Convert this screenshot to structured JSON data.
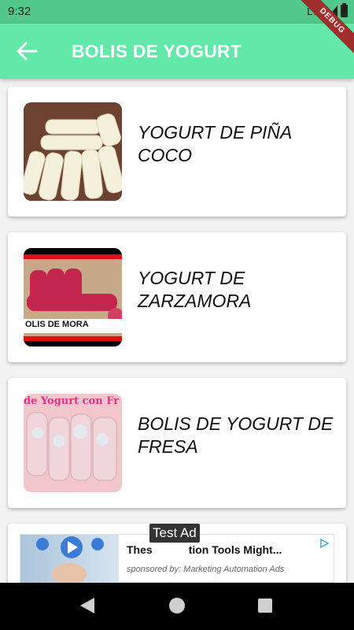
{
  "status_bar": {
    "time": "9:32",
    "network": "LTE"
  },
  "app_bar": {
    "title": "BOLIS DE YOGURT",
    "debug_banner": "DEBUG"
  },
  "items": [
    {
      "title": "YOGURT DE PIÑA COCO"
    },
    {
      "title": "YOGURT DE ZARZAMORA",
      "thumb_caption": "OLIS DE MORA"
    },
    {
      "title": "BOLIS DE YOGURT DE FRESA",
      "thumb_caption": "de Yogurt con Fr"
    }
  ],
  "ad": {
    "label": "Test Ad",
    "headline": "These ... tion Tools Might...",
    "headline_left": "Thes",
    "headline_right": "tion Tools Might...",
    "sponsor": "sponsored by: Marketing Automation Ads"
  },
  "colors": {
    "status_bar": "#52c98b",
    "app_bar": "#62e8a8",
    "debug_ribbon": "#a22d2d"
  }
}
